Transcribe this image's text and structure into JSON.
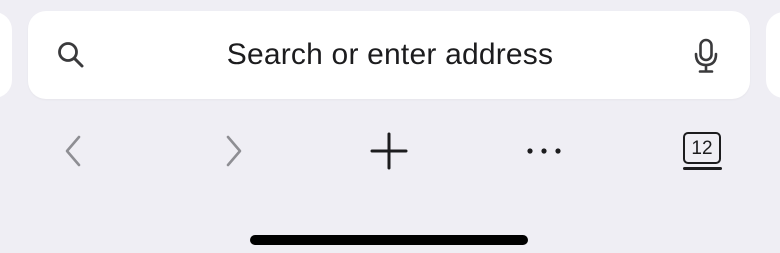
{
  "address_bar": {
    "placeholder": "Search or enter address",
    "left_icon": "search-icon",
    "right_icon": "microphone-icon"
  },
  "toolbar": {
    "buttons": [
      {
        "name": "back",
        "icon": "chevron-left-icon",
        "enabled": false
      },
      {
        "name": "forward",
        "icon": "chevron-right-icon",
        "enabled": false
      },
      {
        "name": "new-tab",
        "icon": "plus-icon",
        "enabled": true
      },
      {
        "name": "more",
        "icon": "ellipsis-icon",
        "enabled": true
      },
      {
        "name": "tabs",
        "icon": "tabs-icon",
        "enabled": true
      }
    ],
    "tab_count": "12"
  },
  "colors": {
    "background": "#efeef4",
    "address_bar_bg": "#ffffff",
    "text_primary": "#1c1c1e",
    "icon_disabled": "#8e8e93",
    "home_indicator": "#000000"
  }
}
